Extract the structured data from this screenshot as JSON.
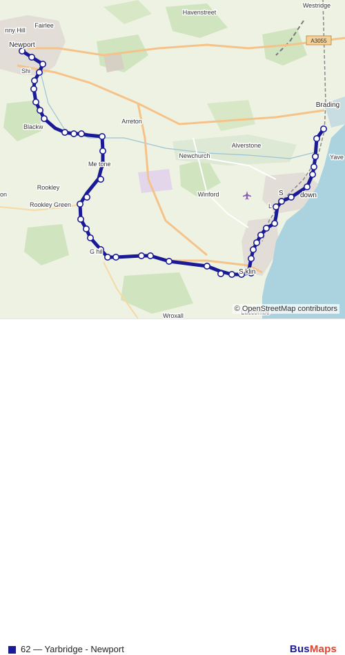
{
  "map": {
    "places": {
      "newport": "Newport",
      "nny_hill": "nny Hill",
      "fairlee": "Fairlee",
      "havenstreet": "Havenstreet",
      "westridge": "Westridge",
      "shide": "Shi",
      "blackwater": "Blackw",
      "arreton": "Arreton",
      "brading": "Brading",
      "merstone": "Me     tone",
      "alverstone": "Alverstone",
      "newchurch": "Newchurch",
      "yaverland": "Yave",
      "rookley": "Rookley",
      "rookley_green": "Rookley Green",
      "winford": "Winford",
      "sandown_s": "S",
      "sandown_town": "down",
      "lake": "L",
      "godshill": "G       hil",
      "shanklin": "S    klin",
      "wroxall": "Wroxall",
      "luccombe": "Luccombe",
      "edge_on": "on"
    },
    "road_ref": "A3055",
    "route_color": "#1a1a96",
    "attribution": "© OpenStreetMap contributors"
  },
  "footer": {
    "route_label": "62 — Yarbridge - Newport",
    "brand_bus": "Bus",
    "brand_maps": "Maps",
    "route_swatch_color": "#1a1a96",
    "brand_accent": "#e0432f"
  }
}
